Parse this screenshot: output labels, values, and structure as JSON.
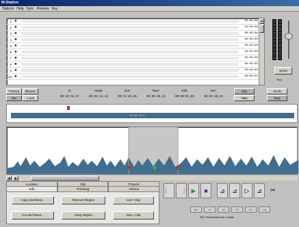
{
  "window": {
    "title": "M-Station",
    "menu": [
      "Options",
      "Help",
      "Sync",
      "Preview",
      "Key"
    ]
  },
  "tracks": [
    {
      "num": "1",
      "time": "00:00:00.00"
    },
    {
      "num": "2",
      "time": "00:00:00.00"
    },
    {
      "num": "3",
      "time": "00:00:00.00"
    },
    {
      "num": "4",
      "time": "00:00:00.00"
    },
    {
      "num": "5",
      "time": "00:00:00.00"
    },
    {
      "num": "6",
      "time": "00:00:00.00"
    },
    {
      "num": "7",
      "time": "00:00:00.00"
    },
    {
      "num": "8",
      "time": "00:00:00.00"
    },
    {
      "num": "9",
      "time": "00:00:00.00"
    },
    {
      "num": "10",
      "time": "00:00:00.00"
    }
  ],
  "meters": {
    "mode_label": "Scrub",
    "mode2_label": "Trim"
  },
  "transport": {
    "left_btn1": "Frames",
    "left_btn2": "Sec",
    "left_btn3": "Minutes",
    "left_btn4": "1 m/s",
    "cols": [
      {
        "label": "In:",
        "value": "00:20:15,27"
      },
      {
        "label": "Head:",
        "value": "00:01:11,13"
      },
      {
        "label": "Out:",
        "value": "00:21:19,86"
      },
      {
        "label": "Now:",
        "value": "00:06:29,31"
      },
      {
        "label": "Edit:",
        "value": "00:00:01,03"
      },
      {
        "label": "Dur:",
        "value": "00:04:20,23"
      }
    ],
    "clip_btn": "Clip",
    "take_btn": "Take",
    "scrub_btn": "Scrub",
    "stop_btn": "Stop"
  },
  "timeline": {
    "label": "0T 1A, TC 1"
  },
  "tabs": [
    {
      "label": "Edit"
    },
    {
      "label": "Trimming"
    },
    {
      "label": "Volume"
    }
  ],
  "tabs_upper": [
    "Location",
    "Clip",
    "Projects"
  ],
  "edit_buttons": [
    {
      "label": "Copy and Move..."
    },
    {
      "label": "Remove Region"
    },
    {
      "label": "List > Clip"
    },
    {
      "label": "Cut and Move..."
    },
    {
      "label": "Keep Region"
    },
    {
      "label": "Seq > Clip"
    }
  ],
  "nav": [
    "|<<",
    "<<",
    "<1",
    "+1",
    ">>",
    ">>|"
  ],
  "status": "Slot 'TimelineScreen': Active"
}
